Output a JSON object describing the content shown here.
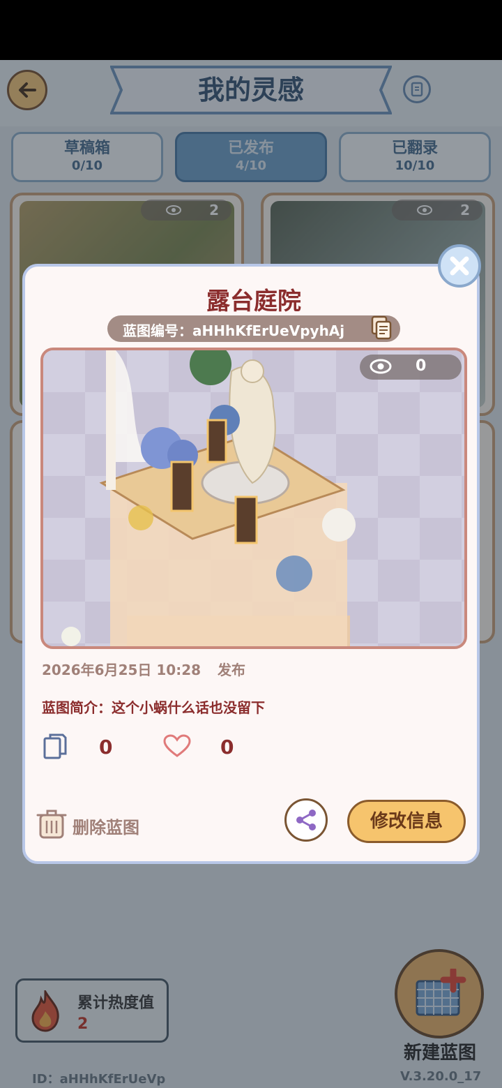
{
  "header": {
    "title": "我的灵感"
  },
  "tabs": [
    {
      "label": "草稿箱",
      "count": "0/10"
    },
    {
      "label": "已发布",
      "count": "4/10"
    },
    {
      "label": "已翻录",
      "count": "10/10"
    }
  ],
  "cards": [
    {
      "views": "2"
    },
    {
      "views": "2"
    }
  ],
  "modal": {
    "title": "露台庭院",
    "blueprint_code": "蓝图编号：aHHhKfErUeVpyhAj",
    "preview_views": "0",
    "publish_date": "2026年6月25日 10:28",
    "publish_label": "发布",
    "description": "蓝图简介：这个小蜗什么话也没留下",
    "copy_count": "0",
    "like_count": "0",
    "delete_label": "删除蓝图",
    "edit_label": "修改信息"
  },
  "footer": {
    "heat_label": "累计热度值",
    "heat_value": "2",
    "new_blueprint_label": "新建蓝图",
    "user_id": "ID：aHHhKfErUeVp",
    "version": "V.3.20.0_17"
  },
  "colors": {
    "accent_blue": "#4b7ba5",
    "title_red": "#8b2d2d",
    "edit_button": "#f6c46d",
    "heat_red": "#c0392b"
  }
}
